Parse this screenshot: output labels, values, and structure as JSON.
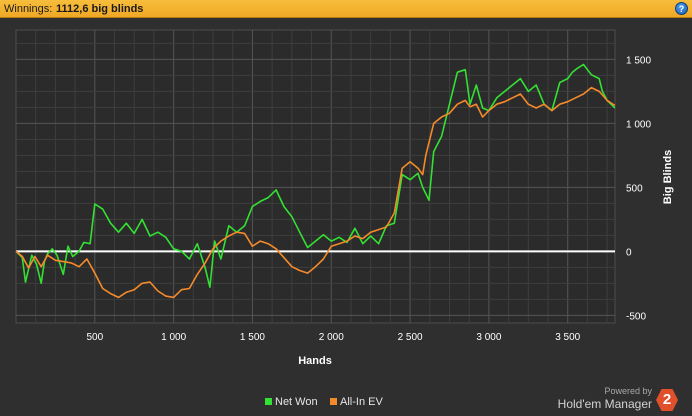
{
  "header": {
    "label": "Winnings:",
    "value": "1112,6 big blinds",
    "help_glyph": "?"
  },
  "chart_data": {
    "type": "line",
    "xlabel": "Hands",
    "ylabel": "Big Blinds",
    "xlim": [
      0,
      3800
    ],
    "ylim": [
      -560,
      1730
    ],
    "x_ticks": [
      500,
      1000,
      1500,
      2000,
      2500,
      3000,
      3500
    ],
    "x_tick_labels": [
      "500",
      "1 000",
      "1 500",
      "2 000",
      "2 500",
      "3 000",
      "3 500"
    ],
    "y_ticks": [
      -500,
      0,
      500,
      1000,
      1500
    ],
    "y_tick_labels": [
      "-500",
      "0",
      "500",
      "1 000",
      "1 500"
    ],
    "grid": true,
    "legend_position": "bottom-center",
    "zero_line": true,
    "series": [
      {
        "name": "Net Won",
        "color": "#33e033",
        "points": [
          [
            0,
            0
          ],
          [
            40,
            -50
          ],
          [
            60,
            -240
          ],
          [
            100,
            -30
          ],
          [
            130,
            -100
          ],
          [
            160,
            -250
          ],
          [
            180,
            -80
          ],
          [
            200,
            -20
          ],
          [
            230,
            20
          ],
          [
            260,
            -30
          ],
          [
            300,
            -180
          ],
          [
            330,
            40
          ],
          [
            360,
            -40
          ],
          [
            400,
            0
          ],
          [
            430,
            70
          ],
          [
            470,
            60
          ],
          [
            500,
            370
          ],
          [
            550,
            330
          ],
          [
            600,
            220
          ],
          [
            650,
            150
          ],
          [
            700,
            220
          ],
          [
            750,
            140
          ],
          [
            800,
            250
          ],
          [
            850,
            120
          ],
          [
            900,
            150
          ],
          [
            950,
            110
          ],
          [
            1000,
            20
          ],
          [
            1050,
            0
          ],
          [
            1100,
            -60
          ],
          [
            1150,
            60
          ],
          [
            1200,
            -130
          ],
          [
            1230,
            -280
          ],
          [
            1260,
            80
          ],
          [
            1300,
            -60
          ],
          [
            1350,
            200
          ],
          [
            1400,
            150
          ],
          [
            1450,
            200
          ],
          [
            1500,
            350
          ],
          [
            1550,
            390
          ],
          [
            1600,
            420
          ],
          [
            1650,
            480
          ],
          [
            1700,
            350
          ],
          [
            1750,
            270
          ],
          [
            1800,
            150
          ],
          [
            1850,
            30
          ],
          [
            1900,
            80
          ],
          [
            1950,
            130
          ],
          [
            2000,
            80
          ],
          [
            2050,
            110
          ],
          [
            2100,
            70
          ],
          [
            2150,
            180
          ],
          [
            2200,
            60
          ],
          [
            2250,
            120
          ],
          [
            2300,
            60
          ],
          [
            2350,
            200
          ],
          [
            2400,
            220
          ],
          [
            2450,
            600
          ],
          [
            2500,
            560
          ],
          [
            2550,
            610
          ],
          [
            2580,
            500
          ],
          [
            2620,
            400
          ],
          [
            2650,
            780
          ],
          [
            2700,
            900
          ],
          [
            2750,
            1150
          ],
          [
            2800,
            1400
          ],
          [
            2850,
            1420
          ],
          [
            2880,
            1150
          ],
          [
            2920,
            1300
          ],
          [
            2960,
            1120
          ],
          [
            3000,
            1100
          ],
          [
            3050,
            1200
          ],
          [
            3100,
            1250
          ],
          [
            3150,
            1300
          ],
          [
            3200,
            1350
          ],
          [
            3250,
            1250
          ],
          [
            3300,
            1300
          ],
          [
            3350,
            1150
          ],
          [
            3400,
            1100
          ],
          [
            3450,
            1320
          ],
          [
            3500,
            1350
          ],
          [
            3530,
            1400
          ],
          [
            3560,
            1430
          ],
          [
            3600,
            1460
          ],
          [
            3650,
            1380
          ],
          [
            3700,
            1350
          ],
          [
            3720,
            1250
          ],
          [
            3750,
            1180
          ],
          [
            3800,
            1120
          ]
        ]
      },
      {
        "name": "All-In EV",
        "color": "#f58a2a",
        "points": [
          [
            0,
            0
          ],
          [
            40,
            -40
          ],
          [
            80,
            -130
          ],
          [
            120,
            -40
          ],
          [
            160,
            -120
          ],
          [
            200,
            -30
          ],
          [
            250,
            -70
          ],
          [
            300,
            -80
          ],
          [
            350,
            -90
          ],
          [
            400,
            -120
          ],
          [
            450,
            -60
          ],
          [
            500,
            -170
          ],
          [
            550,
            -290
          ],
          [
            600,
            -330
          ],
          [
            650,
            -360
          ],
          [
            700,
            -320
          ],
          [
            750,
            -300
          ],
          [
            800,
            -250
          ],
          [
            850,
            -240
          ],
          [
            900,
            -310
          ],
          [
            950,
            -350
          ],
          [
            1000,
            -360
          ],
          [
            1050,
            -300
          ],
          [
            1100,
            -290
          ],
          [
            1150,
            -180
          ],
          [
            1200,
            -90
          ],
          [
            1250,
            20
          ],
          [
            1300,
            80
          ],
          [
            1350,
            120
          ],
          [
            1400,
            150
          ],
          [
            1450,
            140
          ],
          [
            1500,
            40
          ],
          [
            1550,
            80
          ],
          [
            1600,
            60
          ],
          [
            1650,
            20
          ],
          [
            1700,
            -50
          ],
          [
            1750,
            -120
          ],
          [
            1800,
            -150
          ],
          [
            1850,
            -170
          ],
          [
            1900,
            -120
          ],
          [
            1950,
            -60
          ],
          [
            2000,
            40
          ],
          [
            2050,
            60
          ],
          [
            2100,
            80
          ],
          [
            2150,
            120
          ],
          [
            2200,
            100
          ],
          [
            2250,
            150
          ],
          [
            2300,
            170
          ],
          [
            2350,
            190
          ],
          [
            2400,
            300
          ],
          [
            2450,
            650
          ],
          [
            2500,
            700
          ],
          [
            2550,
            650
          ],
          [
            2580,
            600
          ],
          [
            2600,
            750
          ],
          [
            2650,
            1000
          ],
          [
            2700,
            1050
          ],
          [
            2750,
            1080
          ],
          [
            2800,
            1150
          ],
          [
            2850,
            1180
          ],
          [
            2880,
            1130
          ],
          [
            2920,
            1150
          ],
          [
            2960,
            1050
          ],
          [
            3000,
            1100
          ],
          [
            3050,
            1150
          ],
          [
            3100,
            1170
          ],
          [
            3150,
            1200
          ],
          [
            3200,
            1230
          ],
          [
            3250,
            1150
          ],
          [
            3300,
            1120
          ],
          [
            3350,
            1150
          ],
          [
            3400,
            1100
          ],
          [
            3450,
            1150
          ],
          [
            3500,
            1170
          ],
          [
            3550,
            1200
          ],
          [
            3600,
            1230
          ],
          [
            3650,
            1280
          ],
          [
            3700,
            1250
          ],
          [
            3750,
            1180
          ],
          [
            3800,
            1140
          ]
        ]
      }
    ]
  },
  "legend": {
    "items": [
      {
        "label": "Net Won",
        "color": "#33e033"
      },
      {
        "label": "All-In EV",
        "color": "#f58a2a"
      }
    ]
  },
  "branding": {
    "powered_by": "Powered by",
    "product": "Hold'em Manager",
    "logo_glyph": "2"
  }
}
